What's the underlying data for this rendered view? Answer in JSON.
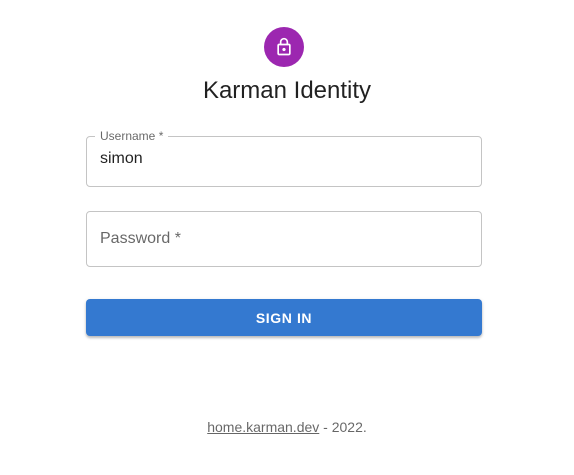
{
  "header": {
    "icon": "lock-icon",
    "icon_color": "#9c27b0",
    "title": "Karman Identity"
  },
  "form": {
    "username": {
      "label": "Username *",
      "value": "simon"
    },
    "password": {
      "placeholder": "Password *",
      "value": ""
    },
    "submit_label": "SIGN IN",
    "submit_color": "#3479d0"
  },
  "footer": {
    "link_text": "home.karman.dev",
    "suffix": " - 2022."
  }
}
